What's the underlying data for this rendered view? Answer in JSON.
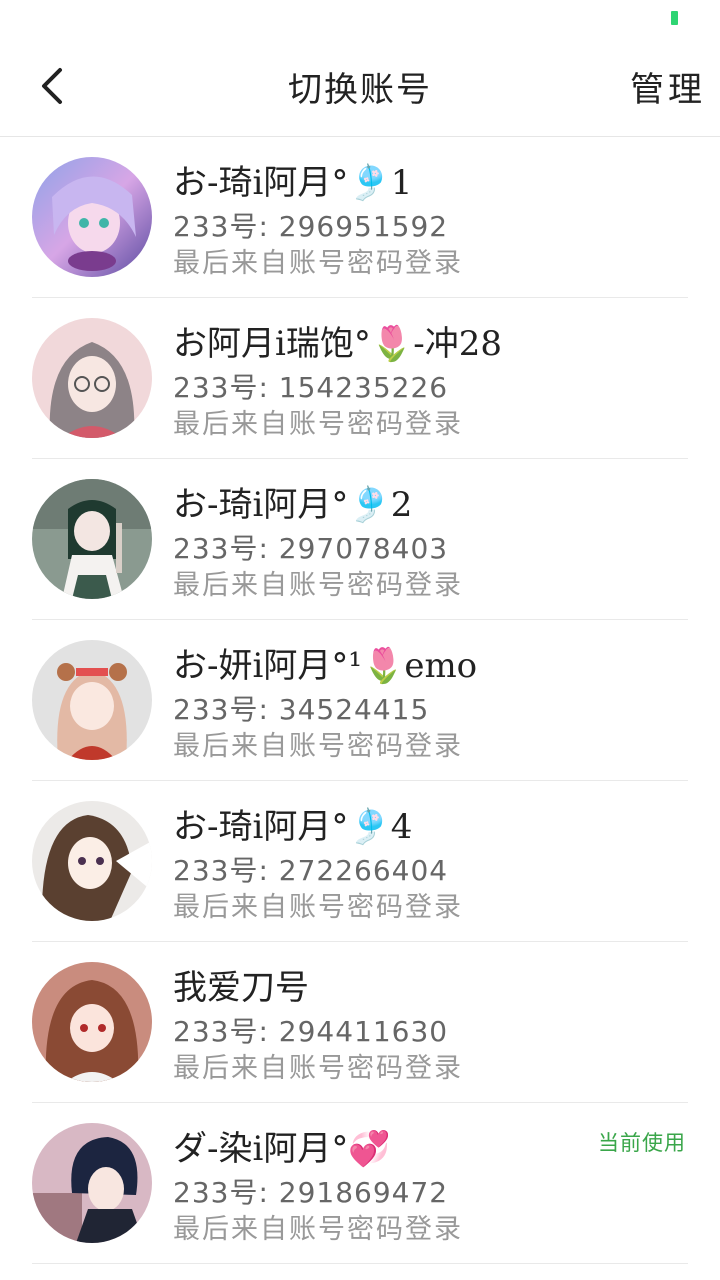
{
  "header": {
    "title": "切换账号",
    "manage_label": "管理"
  },
  "colors": {
    "current_badge": "#3aa64a",
    "status_indicator": "#2ed573"
  },
  "accounts": [
    {
      "name": "お-琦i阿月°🎐1",
      "id_text": "233号: 296951592",
      "login_text": "最后来自账号密码登录",
      "current": ""
    },
    {
      "name": "お阿月i瑞饱°🌷-冲28",
      "id_text": "233号: 154235226",
      "login_text": "最后来自账号密码登录",
      "current": ""
    },
    {
      "name": "お-琦i阿月°🎐2",
      "id_text": "233号: 297078403",
      "login_text": "最后来自账号密码登录",
      "current": ""
    },
    {
      "name": "お-妍i阿月°¹🌷emo",
      "id_text": "233号: 34524415",
      "login_text": "最后来自账号密码登录",
      "current": ""
    },
    {
      "name": "お-琦i阿月°🎐4",
      "id_text": "233号: 272266404",
      "login_text": "最后来自账号密码登录",
      "current": ""
    },
    {
      "name": "我爱刀号",
      "id_text": "233号: 294411630",
      "login_text": "最后来自账号密码登录",
      "current": ""
    },
    {
      "name": "ダ-染i阿月°💞",
      "id_text": "233号: 291869472",
      "login_text": "最后来自账号密码登录",
      "current": "当前使用"
    }
  ]
}
